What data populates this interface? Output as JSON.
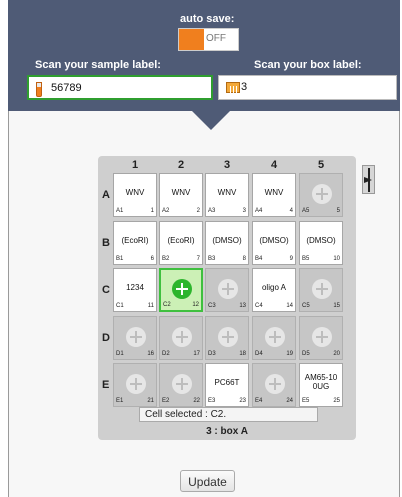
{
  "autosave": {
    "label": "auto save:",
    "state": "OFF"
  },
  "sample": {
    "label": "Scan your sample label:",
    "value": "56789"
  },
  "box": {
    "label": "Scan your box label:",
    "value": "3"
  },
  "grid": {
    "columns": [
      "1",
      "2",
      "3",
      "4",
      "5"
    ],
    "rows": [
      "A",
      "B",
      "C",
      "D",
      "E"
    ],
    "cells": [
      [
        {
          "name": "WNV",
          "pos": "A1",
          "num": "1"
        },
        {
          "name": "WNV",
          "pos": "A2",
          "num": "2"
        },
        {
          "name": "WNV",
          "pos": "A3",
          "num": "3"
        },
        {
          "name": "WNV",
          "pos": "A4",
          "num": "4"
        },
        {
          "name": "",
          "pos": "A5",
          "num": "5",
          "empty": true
        }
      ],
      [
        {
          "name": "(EcoRI)",
          "pos": "B1",
          "num": "6"
        },
        {
          "name": "(EcoRI)",
          "pos": "B2",
          "num": "7"
        },
        {
          "name": "(DMSO)",
          "pos": "B3",
          "num": "8"
        },
        {
          "name": "(DMSO)",
          "pos": "B4",
          "num": "9"
        },
        {
          "name": "(DMSO)",
          "pos": "B5",
          "num": "10"
        }
      ],
      [
        {
          "name": "1234",
          "pos": "C1",
          "num": "11"
        },
        {
          "name": "",
          "pos": "C2",
          "num": "12",
          "empty": true,
          "selected": true
        },
        {
          "name": "",
          "pos": "C3",
          "num": "13",
          "empty": true
        },
        {
          "name": "oligo A",
          "pos": "C4",
          "num": "14"
        },
        {
          "name": "",
          "pos": "C5",
          "num": "15",
          "empty": true
        }
      ],
      [
        {
          "name": "",
          "pos": "D1",
          "num": "16",
          "empty": true
        },
        {
          "name": "",
          "pos": "D2",
          "num": "17",
          "empty": true
        },
        {
          "name": "",
          "pos": "D3",
          "num": "18",
          "empty": true
        },
        {
          "name": "",
          "pos": "D4",
          "num": "19",
          "empty": true
        },
        {
          "name": "",
          "pos": "D5",
          "num": "20",
          "empty": true
        }
      ],
      [
        {
          "name": "",
          "pos": "E1",
          "num": "21",
          "empty": true
        },
        {
          "name": "",
          "pos": "E2",
          "num": "22",
          "empty": true
        },
        {
          "name": "PC66T",
          "pos": "E3",
          "num": "23"
        },
        {
          "name": "",
          "pos": "E4",
          "num": "24",
          "empty": true
        },
        {
          "name": "AM65-10\n0UG",
          "pos": "E5",
          "num": "25"
        }
      ]
    ]
  },
  "cell_selected": "Cell selected : C2.",
  "box_name": "3 : box A",
  "update_label": "Update",
  "colors": {
    "header": "#4f5b76",
    "accent": "#f07f1e",
    "selected": "#2db52d"
  }
}
